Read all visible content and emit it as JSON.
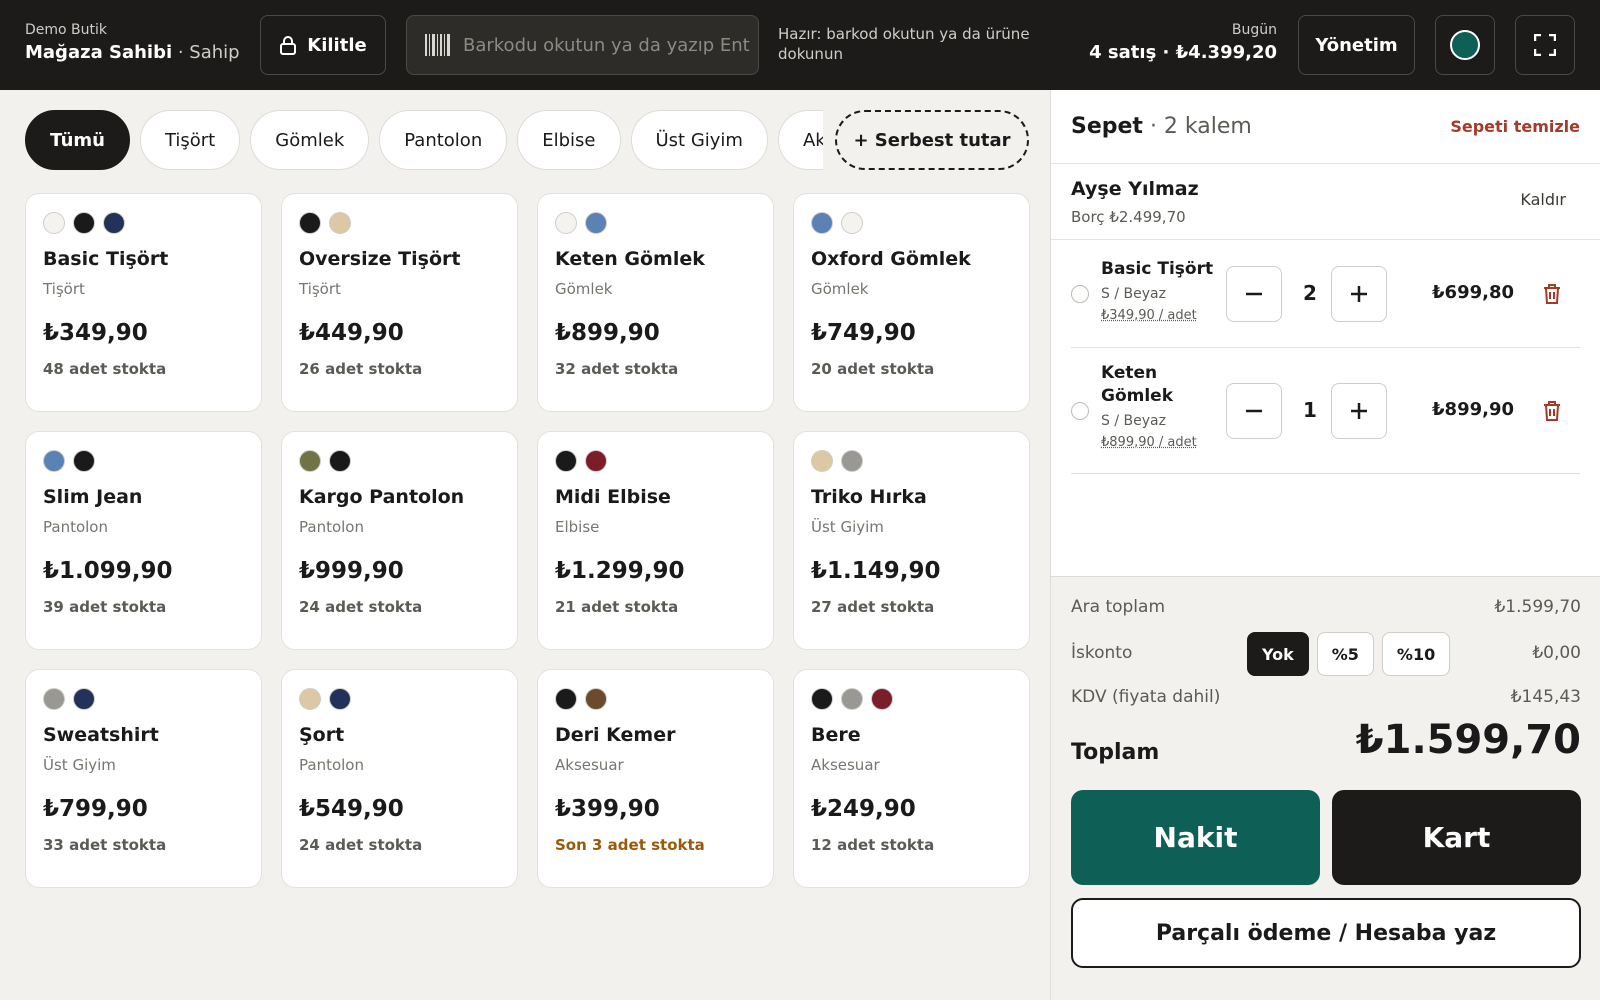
{
  "header": {
    "store": "Demo Butik",
    "user": "Mağaza Sahibi",
    "role": " · Sahip",
    "lock_label": "Kilitle",
    "scan_placeholder": "Barkodu okutun ya da yazıp Ent",
    "hint": "Hazır: barkod okutun ya da ürüne dokunun",
    "today_label": "Bugün",
    "today_value": "4 satış · ₺4.399,20",
    "management_label": "Yönetim"
  },
  "tabs": [
    "Tümü",
    "Tişört",
    "Gömlek",
    "Pantolon",
    "Elbise",
    "Üst Giyim",
    "Aksesuar"
  ],
  "free_amount_label": "+ Serbest tutar",
  "products": [
    {
      "name": "Basic Tişört",
      "category": "Tişört",
      "price": "₺349,90",
      "stock": "48 adet stokta",
      "low": false,
      "colors": [
        "#f4f3ef",
        "#1a1a1a",
        "#233258"
      ]
    },
    {
      "name": "Oversize Tişört",
      "category": "Tişört",
      "price": "₺449,90",
      "stock": "26 adet stokta",
      "low": false,
      "colors": [
        "#1a1a1a",
        "#dcc8a4"
      ]
    },
    {
      "name": "Keten Gömlek",
      "category": "Gömlek",
      "price": "₺899,90",
      "stock": "32 adet stokta",
      "low": false,
      "colors": [
        "#f4f3ef",
        "#5b82b4"
      ]
    },
    {
      "name": "Oxford Gömlek",
      "category": "Gömlek",
      "price": "₺749,90",
      "stock": "20 adet stokta",
      "low": false,
      "colors": [
        "#5b82b4",
        "#f4f3ef"
      ]
    },
    {
      "name": "Slim Jean",
      "category": "Pantolon",
      "price": "₺1.099,90",
      "stock": "39 adet stokta",
      "low": false,
      "colors": [
        "#5b82b4",
        "#1a1a1a"
      ]
    },
    {
      "name": "Kargo Pantolon",
      "category": "Pantolon",
      "price": "₺999,90",
      "stock": "24 adet stokta",
      "low": false,
      "colors": [
        "#6f7345",
        "#1a1a1a"
      ]
    },
    {
      "name": "Midi Elbise",
      "category": "Elbise",
      "price": "₺1.299,90",
      "stock": "21 adet stokta",
      "low": false,
      "colors": [
        "#1a1a1a",
        "#7c1d2a"
      ]
    },
    {
      "name": "Triko Hırka",
      "category": "Üst Giyim",
      "price": "₺1.149,90",
      "stock": "27 adet stokta",
      "low": false,
      "colors": [
        "#dcc8a4",
        "#9a9893"
      ]
    },
    {
      "name": "Sweatshirt",
      "category": "Üst Giyim",
      "price": "₺799,90",
      "stock": "33 adet stokta",
      "low": false,
      "colors": [
        "#9a9893",
        "#233258"
      ]
    },
    {
      "name": "Şort",
      "category": "Pantolon",
      "price": "₺549,90",
      "stock": "24 adet stokta",
      "low": false,
      "colors": [
        "#dcc8a4",
        "#233258"
      ]
    },
    {
      "name": "Deri Kemer",
      "category": "Aksesuar",
      "price": "₺399,90",
      "stock": "Son 3 adet stokta",
      "low": true,
      "colors": [
        "#1a1a1a",
        "#6b4a2e"
      ]
    },
    {
      "name": "Bere",
      "category": "Aksesuar",
      "price": "₺249,90",
      "stock": "12 adet stokta",
      "low": false,
      "colors": [
        "#1a1a1a",
        "#9a9893",
        "#7c1d2a"
      ]
    }
  ],
  "cart": {
    "title": "Sepet",
    "count": " · 2 kalem",
    "clear_label": "Sepeti temizle",
    "customer_name": "Ayşe Yılmaz",
    "customer_debt": "Borç ₺2.499,70",
    "remove_label": "Kaldır",
    "lines": [
      {
        "name": "Basic Tişört",
        "variant": "S / Beyaz",
        "unit": "₺349,90 / adet",
        "qty": "2",
        "total": "₺699,80"
      },
      {
        "name": "Keten Gömlek",
        "variant": "S / Beyaz",
        "unit": "₺899,90 / adet",
        "qty": "1",
        "total": "₺899,90"
      }
    ]
  },
  "summary": {
    "subtotal_label": "Ara toplam",
    "subtotal": "₺1.599,70",
    "discount_label": "İskonto",
    "discount_options": [
      "Yok",
      "%5",
      "%10"
    ],
    "discount_value": "₺0,00",
    "vat_label": "KDV (fiyata dahil)",
    "vat_value": "₺145,43",
    "total_label": "Toplam",
    "total_value": "₺1.599,70",
    "cash_label": "Nakit",
    "card_label": "Kart",
    "split_label": "Parçalı ödeme / Hesaba yaz"
  },
  "colors": {
    "accent": "#0e5f55",
    "dark": "#1c1b19",
    "danger": "#a33a2a",
    "low_stock": "#9a5a0a"
  }
}
